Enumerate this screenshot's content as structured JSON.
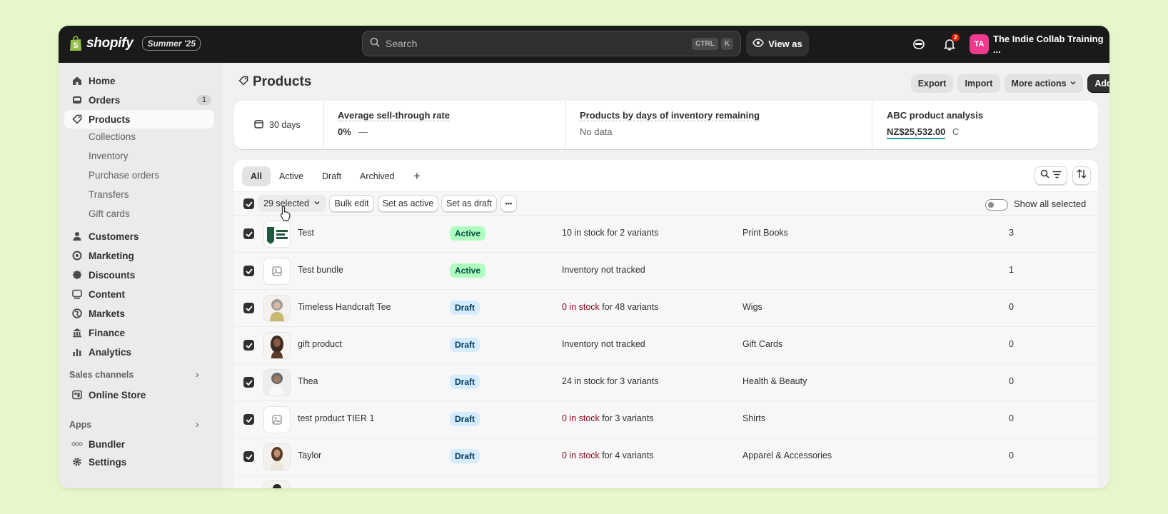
{
  "topbar": {
    "logo_text": "shopify",
    "badge": "Summer '25",
    "search_placeholder": "Search",
    "kbd_ctrl": "CTRL",
    "kbd_k": "K",
    "view_as": "View as",
    "notification_count": "2",
    "avatar_initials": "TA",
    "store_name": "The Indie Collab Training ..."
  },
  "sidebar": {
    "items": [
      {
        "label": "Home",
        "icon": "home-icon"
      },
      {
        "label": "Orders",
        "icon": "inbox-icon",
        "count": "1"
      },
      {
        "label": "Products",
        "icon": "tag-icon"
      }
    ],
    "sub_items": [
      "Collections",
      "Inventory",
      "Purchase orders",
      "Transfers",
      "Gift cards"
    ],
    "items2": [
      {
        "label": "Customers",
        "icon": "person-icon"
      },
      {
        "label": "Marketing",
        "icon": "target-icon"
      },
      {
        "label": "Discounts",
        "icon": "discount-icon"
      },
      {
        "label": "Content",
        "icon": "content-icon"
      },
      {
        "label": "Markets",
        "icon": "globe-icon"
      },
      {
        "label": "Finance",
        "icon": "bank-icon"
      },
      {
        "label": "Analytics",
        "icon": "chart-icon"
      }
    ],
    "sales_channels_label": "Sales channels",
    "online_store": "Online Store",
    "apps_label": "Apps",
    "bundler": "Bundler",
    "settings": "Settings"
  },
  "page": {
    "title": "Products",
    "export": "Export",
    "import": "Import",
    "more_actions": "More actions",
    "add_product": "Add product"
  },
  "metrics": {
    "period": "30 days",
    "sell_through_title": "Average sell-through rate",
    "sell_through_value": "0%",
    "sell_through_dash": "—",
    "days_inventory_title": "Products by days of inventory remaining",
    "days_inventory_value": "No data",
    "abc_title": "ABC product analysis",
    "abc_value": "NZ$25,532.00",
    "abc_grade": "C"
  },
  "tabs": [
    "All",
    "Active",
    "Draft",
    "Archived"
  ],
  "bulk": {
    "selected": "29 selected",
    "bulk_edit": "Bulk edit",
    "set_active": "Set as active",
    "set_draft": "Set as draft",
    "more": "•••",
    "show_all_selected": "Show all selected"
  },
  "products": [
    {
      "name": "Test",
      "status": "Active",
      "stock_red": "",
      "stock_rest": "10 in stock for 2 variants",
      "category": "Print Books",
      "count": "3"
    },
    {
      "name": "Test bundle",
      "status": "Active",
      "stock_red": "",
      "stock_rest": "Inventory not tracked",
      "category": "",
      "count": "1"
    },
    {
      "name": "Timeless Handcraft Tee",
      "status": "Draft",
      "stock_red": "0 in stock",
      "stock_rest": " for 48 variants",
      "category": "Wigs",
      "count": "0"
    },
    {
      "name": "gift product",
      "status": "Draft",
      "stock_red": "",
      "stock_rest": "Inventory not tracked",
      "category": "Gift Cards",
      "count": "0"
    },
    {
      "name": "Thea",
      "status": "Draft",
      "stock_red": "",
      "stock_rest": "24 in stock for 3 variants",
      "category": "Health & Beauty",
      "count": "0"
    },
    {
      "name": "test product TIER 1",
      "status": "Draft",
      "stock_red": "0 in stock",
      "stock_rest": " for 3 variants",
      "category": "Shirts",
      "count": "0"
    },
    {
      "name": "Taylor",
      "status": "Draft",
      "stock_red": "0 in stock",
      "stock_rest": " for 4 variants",
      "category": "Apparel & Accessories",
      "count": "0"
    }
  ],
  "colors": {
    "topbar": "#1a1a1a",
    "active_badge": "#affebf",
    "draft_badge": "#d5ebff",
    "out_of_stock": "#8e0b21",
    "avatar": "#ef3a8d"
  }
}
